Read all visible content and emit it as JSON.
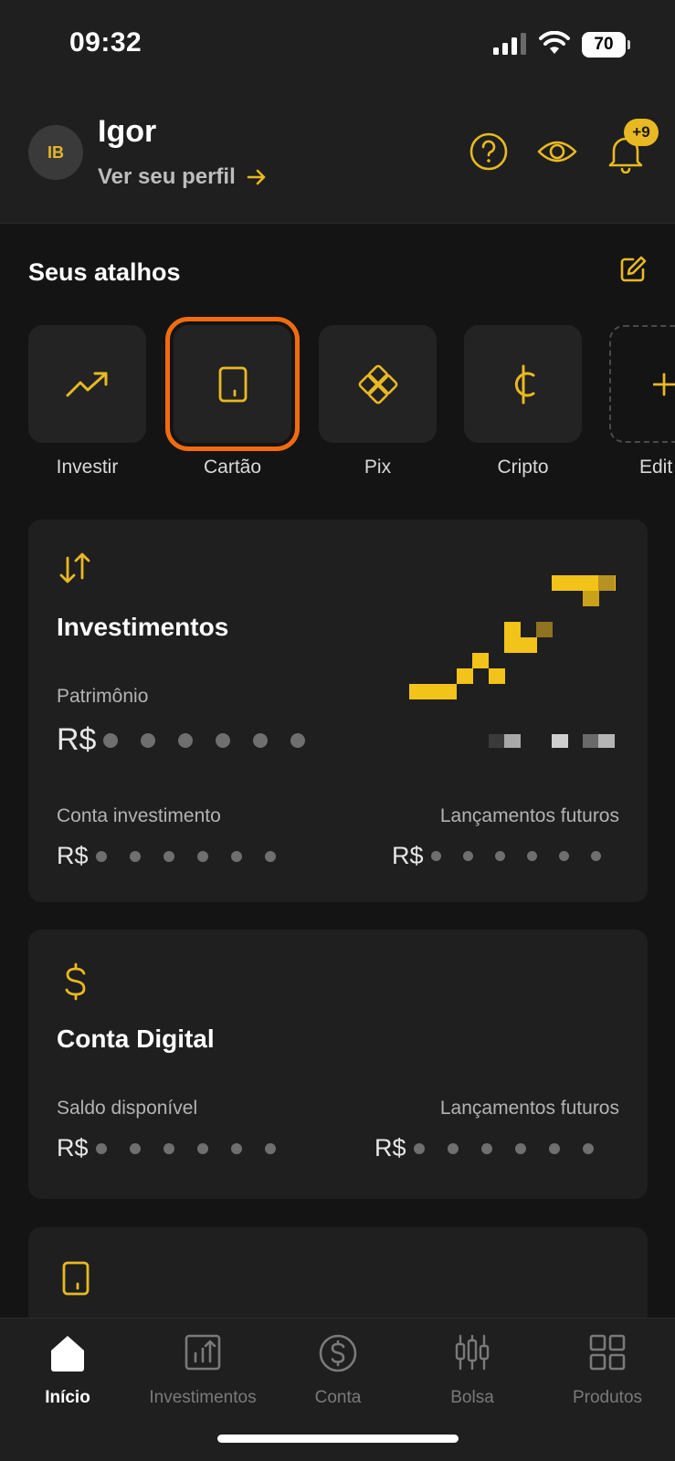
{
  "status": {
    "time": "09:32",
    "battery": "70"
  },
  "header": {
    "avatar_initials": "IB",
    "user_name": "Igor",
    "profile_link": "Ver seu perfil",
    "notifications_badge": "+9",
    "icons": [
      "help-circle-icon",
      "eye-icon",
      "bell-icon"
    ]
  },
  "shortcuts": {
    "title": "Seus atalhos",
    "items": [
      {
        "label": "Investir",
        "icon": "trending-up-icon"
      },
      {
        "label": "Cartão",
        "icon": "card-icon"
      },
      {
        "label": "Pix",
        "icon": "pix-icon"
      },
      {
        "label": "Cripto",
        "icon": "crypto-icon"
      },
      {
        "label": "Edit",
        "icon": "plus-icon"
      }
    ]
  },
  "investimentos": {
    "title": "Investimentos",
    "patrimonio_label": "Patrimônio",
    "currency": "R$",
    "conta_label": "Conta investimento",
    "futuros_label": "Lançamentos futuros"
  },
  "conta_digital": {
    "title": "Conta Digital",
    "saldo_label": "Saldo disponível",
    "currency": "R$",
    "futuros_label": "Lançamentos futuros"
  },
  "bottom_nav": [
    {
      "label": "Início",
      "active": true
    },
    {
      "label": "Investimentos",
      "active": false
    },
    {
      "label": "Conta",
      "active": false
    },
    {
      "label": "Bolsa",
      "active": false
    },
    {
      "label": "Produtos",
      "active": false
    }
  ],
  "colors": {
    "accent": "#e8b923",
    "highlight": "#f26b0f",
    "background": "#141414",
    "card": "#1f1f1f"
  }
}
